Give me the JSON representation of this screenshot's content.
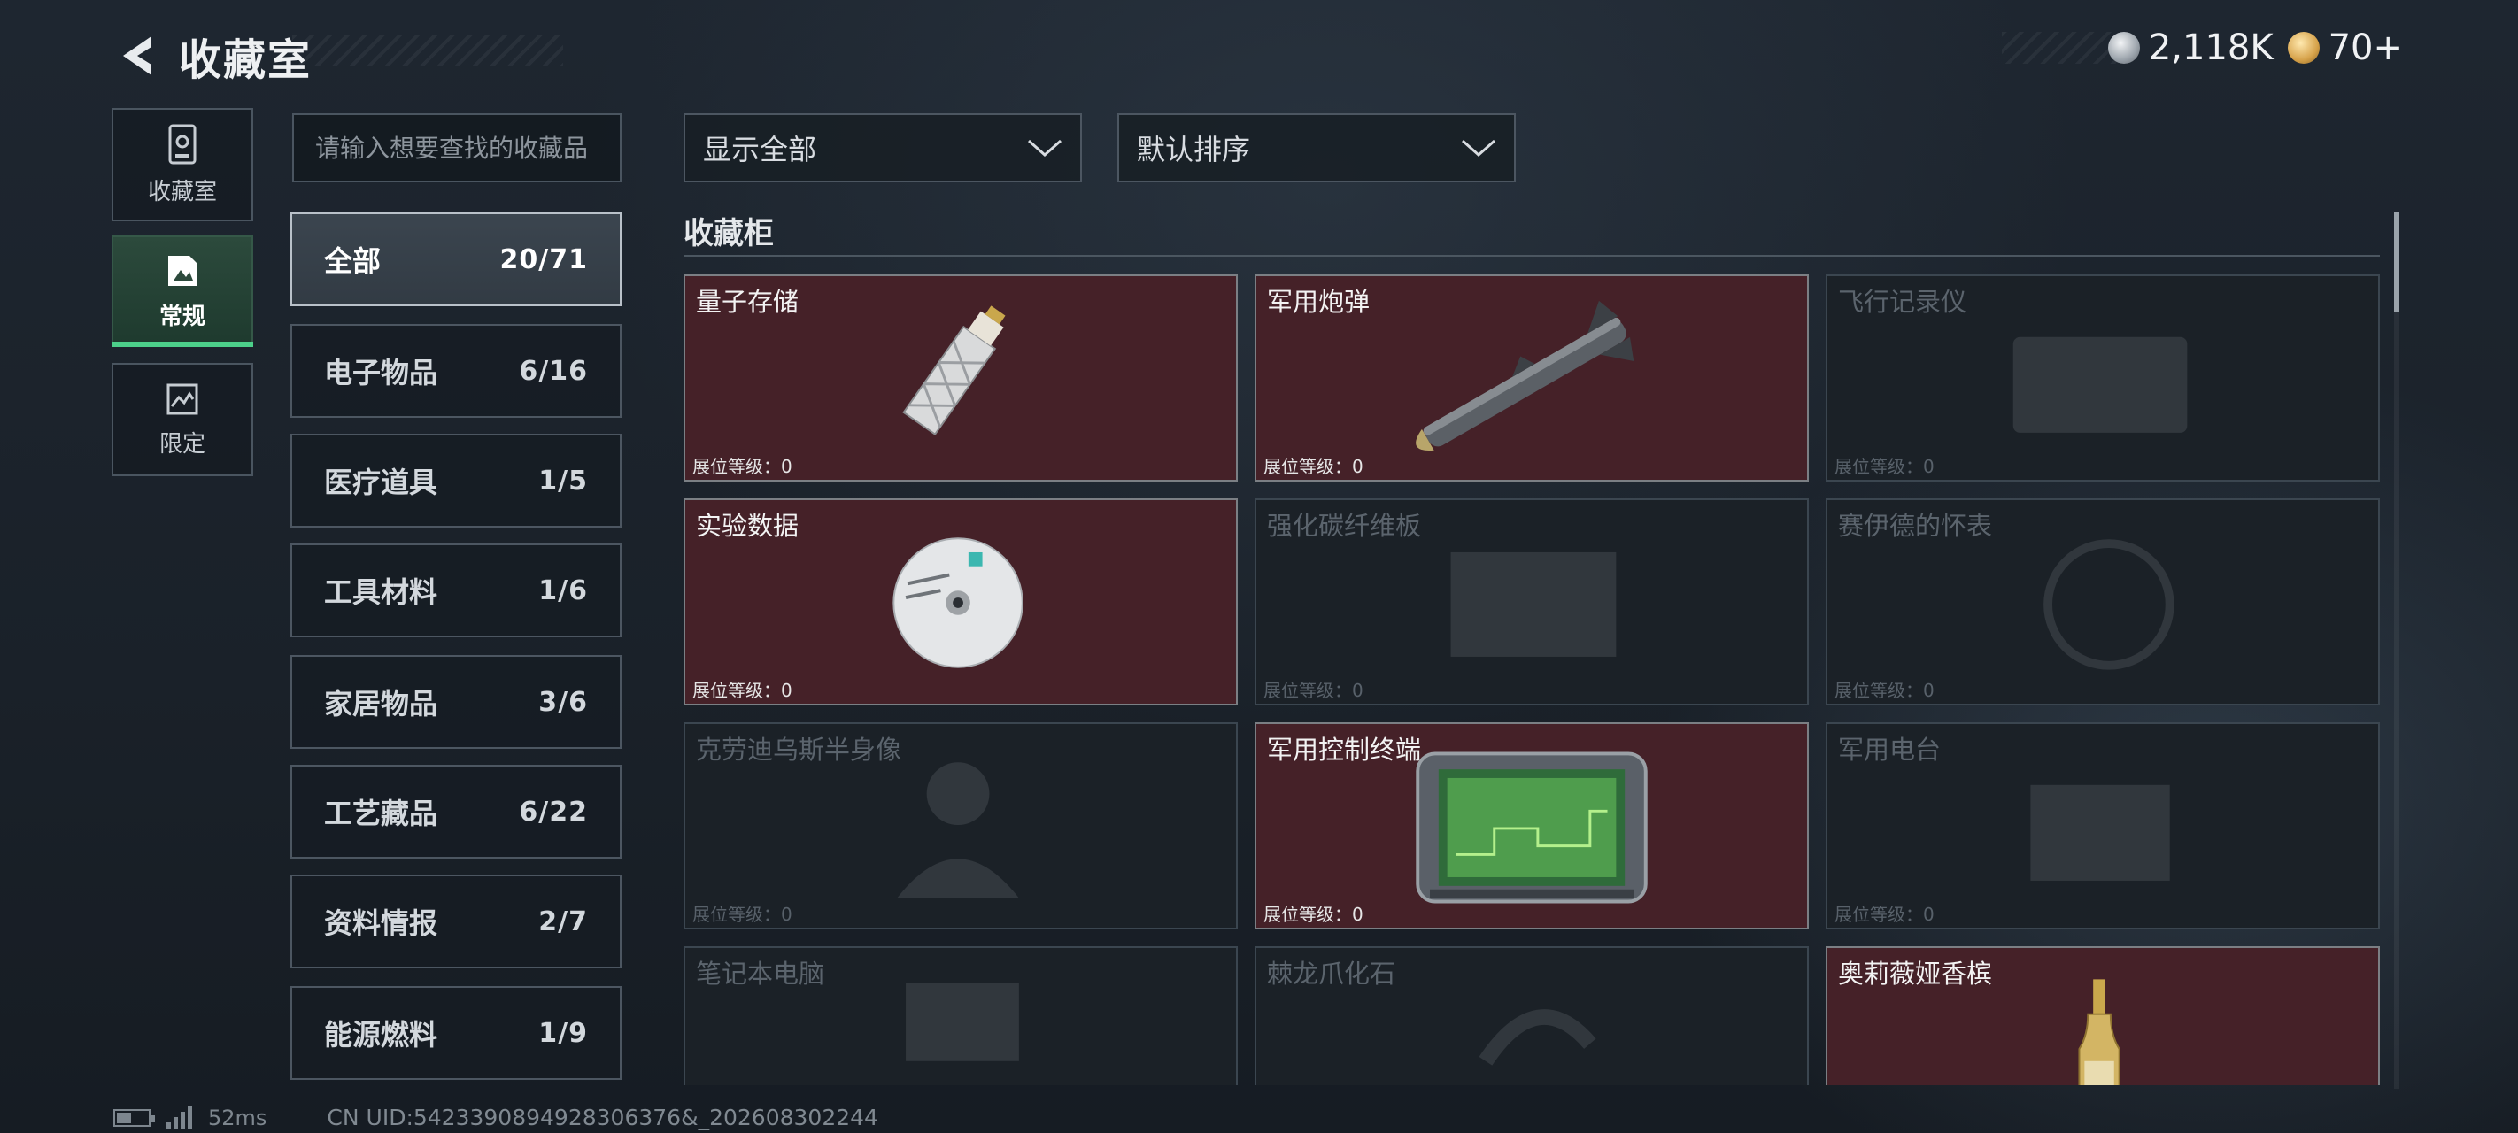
{
  "header": {
    "title": "收藏室",
    "currency1": "2,118K",
    "currency2": "70+"
  },
  "side_nav": [
    {
      "label": "收藏室",
      "icon": "collection-room-icon",
      "active": false
    },
    {
      "label": "常规",
      "icon": "regular-icon",
      "active": true
    },
    {
      "label": "限定",
      "icon": "limited-icon",
      "active": false
    }
  ],
  "search": {
    "placeholder": "请输入想要查找的收藏品"
  },
  "categories": [
    {
      "label": "全部",
      "count": "20/71",
      "active": true
    },
    {
      "label": "电子物品",
      "count": "6/16"
    },
    {
      "label": "医疗道具",
      "count": "1/5"
    },
    {
      "label": "工具材料",
      "count": "1/6"
    },
    {
      "label": "家居物品",
      "count": "3/6"
    },
    {
      "label": "工艺藏品",
      "count": "6/22"
    },
    {
      "label": "资料情报",
      "count": "2/7"
    },
    {
      "label": "能源燃料",
      "count": "1/9"
    }
  ],
  "filters": {
    "display": "显示全部",
    "sort": "默认排序"
  },
  "section_title": "收藏柜",
  "items": [
    {
      "name": "量子存储",
      "level": "展位等级：0",
      "owned": true,
      "icon": "usb-drive-icon"
    },
    {
      "name": "军用炮弹",
      "level": "展位等级：0",
      "owned": true,
      "icon": "missile-icon"
    },
    {
      "name": "飞行记录仪",
      "level": "展位等级：0",
      "owned": false,
      "icon": "flight-recorder-icon"
    },
    {
      "name": "实验数据",
      "level": "展位等级：0",
      "owned": true,
      "icon": "disc-icon"
    },
    {
      "name": "强化碳纤维板",
      "level": "展位等级：0",
      "owned": false,
      "icon": "carbon-plate-icon"
    },
    {
      "name": "赛伊德的怀表",
      "level": "展位等级：0",
      "owned": false,
      "icon": "pocket-watch-icon"
    },
    {
      "name": "克劳迪乌斯半身像",
      "level": "展位等级：0",
      "owned": false,
      "icon": "bust-icon"
    },
    {
      "name": "军用控制终端",
      "level": "展位等级：0",
      "owned": true,
      "icon": "control-terminal-icon"
    },
    {
      "name": "军用电台",
      "level": "展位等级：0",
      "owned": false,
      "icon": "radio-icon"
    },
    {
      "name": "笔记本电脑",
      "level": "",
      "owned": false,
      "icon": "laptop-icon"
    },
    {
      "name": "棘龙爪化石",
      "level": "",
      "owned": false,
      "icon": "fossil-icon"
    },
    {
      "name": "奥莉薇娅香槟",
      "level": "",
      "owned": true,
      "icon": "champagne-icon"
    }
  ],
  "footer": {
    "ping": "52ms",
    "uid": "CN UID:5423390894928306376&_202608302244"
  },
  "colors": {
    "owned_card": "#452128",
    "locked_card": "#1b2127",
    "active_nav": "#4cd08a"
  }
}
